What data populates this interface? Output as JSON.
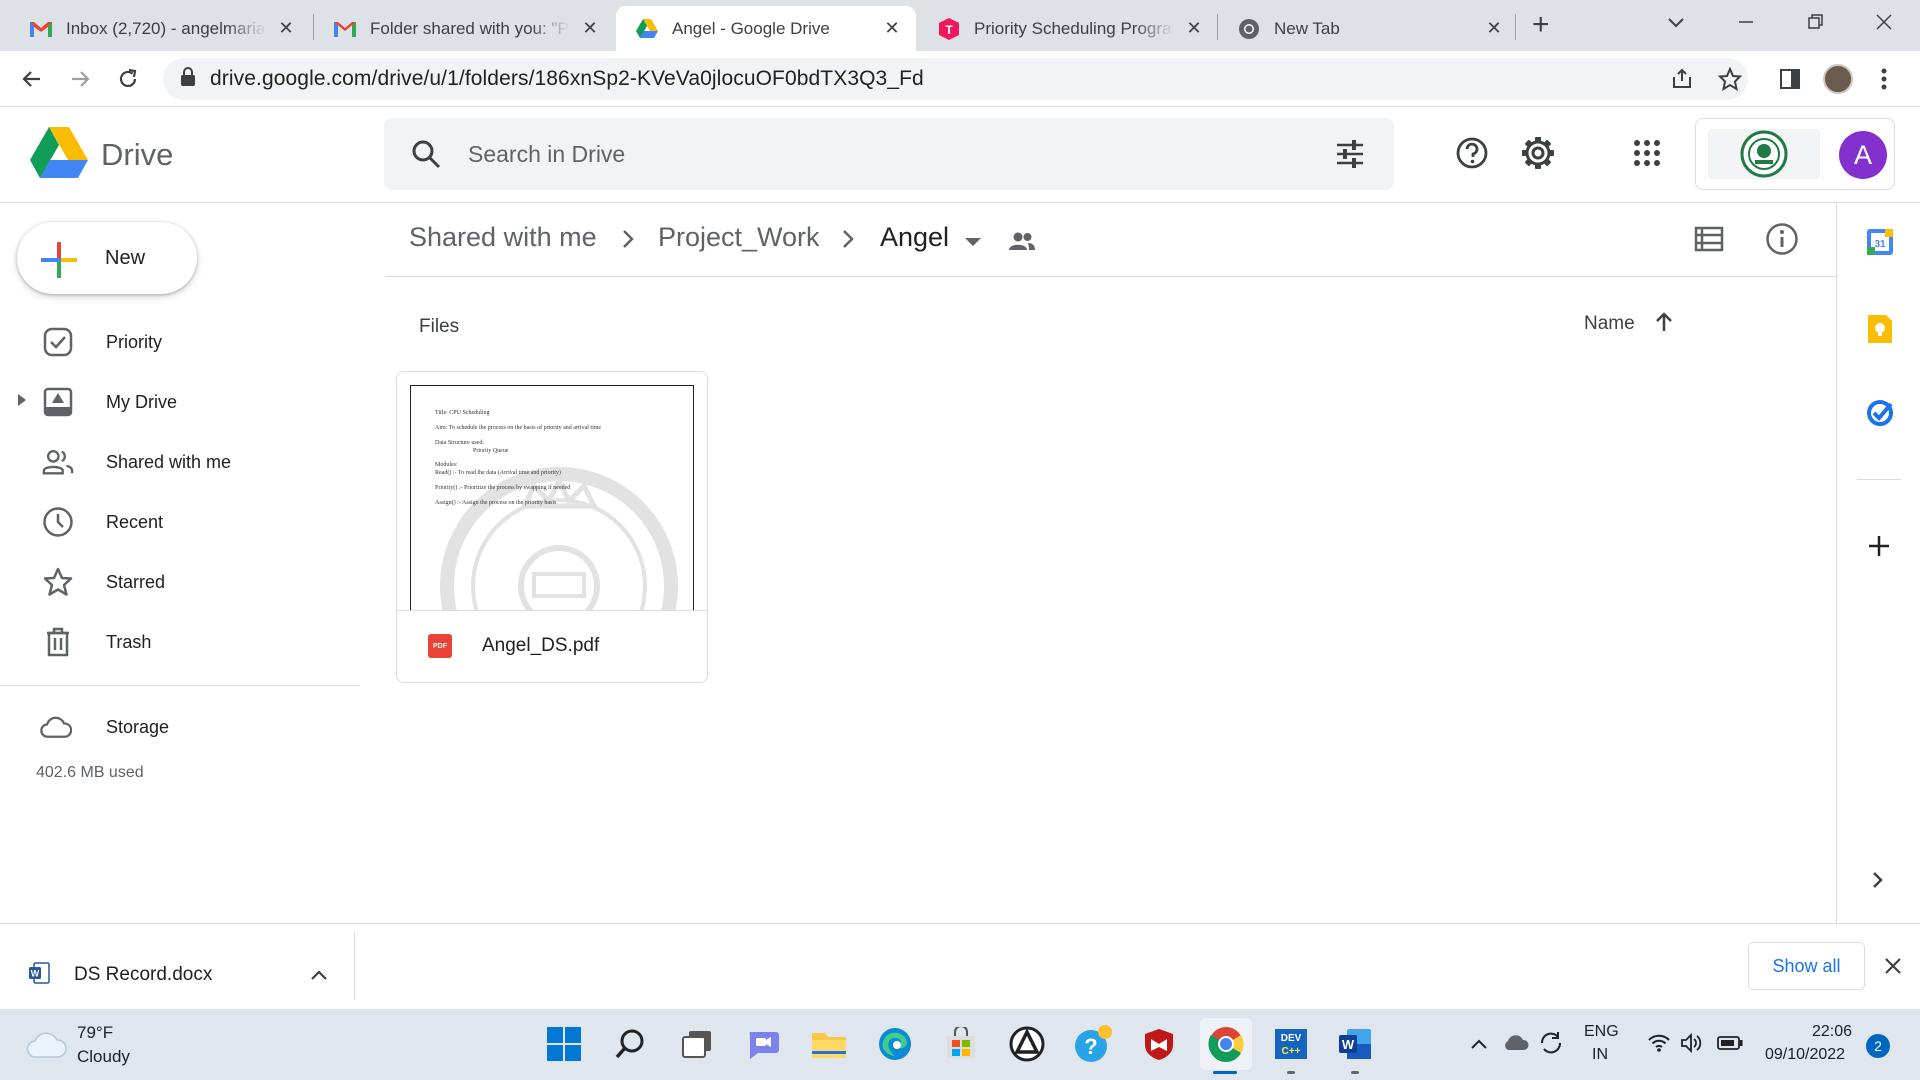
{
  "browser": {
    "tabs": [
      {
        "title": "Inbox (2,720) - angelmaria",
        "icon": "gmail-icon"
      },
      {
        "title": "Folder shared with you: \"Project_Work\"",
        "icon": "gmail-icon"
      },
      {
        "title": "Angel - Google Drive",
        "icon": "google-drive-icon",
        "active": true
      },
      {
        "title": "Priority Scheduling Program",
        "icon": "tinkercad-icon"
      },
      {
        "title": "New Tab",
        "icon": "chrome-icon"
      }
    ],
    "close_glyph": "✕",
    "new_tab_glyph": "+",
    "url": "drive.google.com/drive/u/1/folders/186xnSp2-KVeVa0jlocuOF0bdTX3Q3_Fd"
  },
  "drive": {
    "brand": "Drive",
    "search_placeholder": "Search in Drive",
    "avatar_letter": "A",
    "avatar_color": "#8430ce",
    "new_button": "New",
    "nav": [
      {
        "label": "Priority",
        "icon": "priority-icon"
      },
      {
        "label": "My Drive",
        "icon": "my-drive-icon"
      },
      {
        "label": "Shared with me",
        "icon": "shared-icon"
      },
      {
        "label": "Recent",
        "icon": "clock-icon"
      },
      {
        "label": "Starred",
        "icon": "star-icon"
      },
      {
        "label": "Trash",
        "icon": "trash-icon"
      }
    ],
    "storage": {
      "label": "Storage",
      "used": "402.6 MB used"
    },
    "breadcrumb": [
      "Shared with me",
      "Project_Work",
      "Angel"
    ],
    "files_heading": "Files",
    "sort_label": "Name",
    "files": [
      {
        "name": "Angel_DS.pdf",
        "type_badge": "PDF",
        "preview_lines": [
          "Title: CPU Scheduling",
          "Aim: To schedule the process on the basis of priority and arrival time",
          "Data Structure used:",
          "Priority Queue",
          "Modules:",
          "Read() :- To read the data (Arrival time and priority)",
          "Priority() :- Prioritize the process by swapping if needed",
          "Assign() :- Assign the process on the priority basis"
        ]
      }
    ]
  },
  "downloads": {
    "file": "DS Record.docx",
    "show_all": "Show all"
  },
  "taskbar": {
    "weather_temp": "79°F",
    "weather_desc": "Cloudy",
    "lang": "ENG",
    "region": "IN",
    "time": "22:06",
    "date": "09/10/2022",
    "notification_count": "2",
    "apps": [
      "start-icon",
      "search-icon",
      "task-view-icon",
      "teams-chat-icon",
      "file-explorer-icon",
      "edge-icon",
      "store-icon",
      "github-icon",
      "help-icon",
      "mcafee-icon",
      "chrome-icon",
      "dev-cpp-icon",
      "word-icon"
    ]
  }
}
